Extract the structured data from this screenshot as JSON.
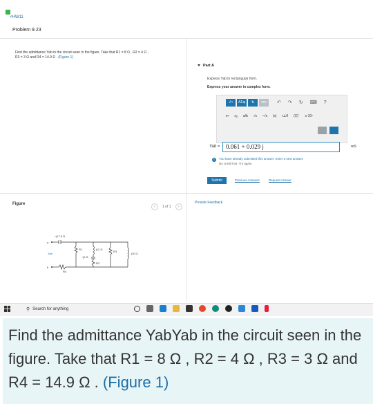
{
  "nav": {
    "back_label": "<HW11"
  },
  "problem": {
    "title": "Problem 9.23",
    "statement_line1": "Find the admittance Yab in the circuit seen in the figure. Take that R1 = 8 Ω , R2 = 4 Ω ,",
    "statement_line2": "R3 = 3 Ω and R4 = 14.9 Ω .",
    "figure_link": "(Figure 1)"
  },
  "part": {
    "label": "Part A",
    "instruction1": "Express Yab in rectangular form.",
    "instruction2": "Express your answer in complex form."
  },
  "toolbar": {
    "row1": [
      "√□",
      "AΣφ",
      "⇅",
      "vec"
    ],
    "row1_icons": [
      "↶",
      "↷",
      "↻",
      "⌨",
      "?"
    ],
    "row2": [
      "xᵃ",
      "xᵦ",
      "a/b",
      "√x",
      "ⁿ√x",
      "|x|",
      "r∠θ",
      "(X)´",
      "x·10ⁿ"
    ]
  },
  "answer": {
    "variable_label": "Yab =",
    "value": "0.061 + 0.029 j",
    "units": "mS",
    "feedback_line1": "You have already submitted this answer. Enter a new answer.",
    "feedback_line2": "No credit lost. Try again."
  },
  "actions": {
    "submit_label": "Submit",
    "previous_answers_label": "Previous Answers",
    "request_answer_label": "Request Answer",
    "provide_feedback_label": "Provide Feedback"
  },
  "figure_panel": {
    "label": "Figure",
    "pager_text": "1 of 1",
    "labels": {
      "cap_top": "−j17.8 Ω",
      "a": "a",
      "b": "b",
      "r1": "R1",
      "r2": "R2",
      "r3": "R3",
      "r4": "R4",
      "yab": "Yab",
      "j12": "j12 Ω",
      "neg_j2": "−j2 Ω",
      "j10": "j10 Ω"
    }
  },
  "taskbar": {
    "search_placeholder": "Search for anything"
  },
  "caption": {
    "line_part1": "Find the admittance YabYab in the circuit seen in the figure. Take that R1 = 8 Ω , R2 = 4 Ω , R3 = 3 Ω and R4 = 14.9 Ω . ",
    "figure_link": "(Figure 1)"
  },
  "colors": {
    "accent": "#1f74ad",
    "link": "#1a6ea8",
    "caption_bg": "#e8f5f7",
    "brand_green": "#3bb54a"
  }
}
